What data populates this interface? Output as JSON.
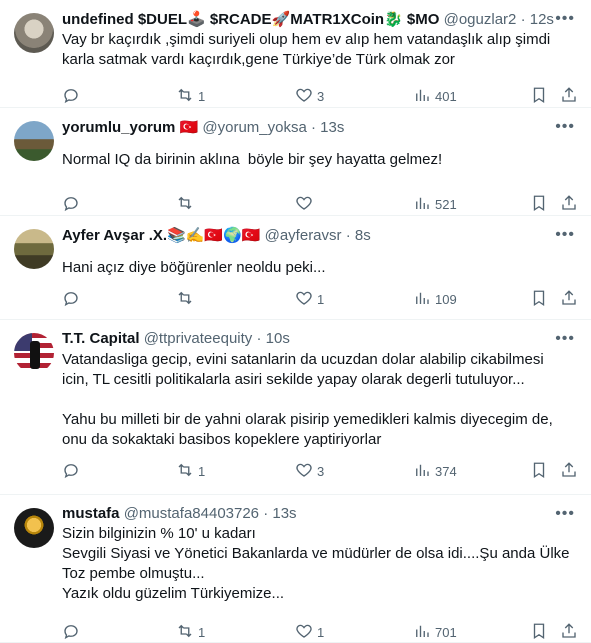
{
  "tweets": [
    {
      "name": "undefined $DUEL🕹️ $RCADE🚀MATR1XCoin🐉 $MO",
      "handle": "@oguzlar2",
      "time": "12s",
      "text": "Vay br kaçırdık ,şimdi suriyeli olup hem ev alıp hem vatandaşlık alıp şimdi karla satmak vardı kaçırdık,gene Türkiye’de Türk olmak zor",
      "replies": "",
      "retweets": "1",
      "likes": "3",
      "views": "401"
    },
    {
      "name": "yorumlu_yorum 🇹🇷",
      "handle": "@yorum_yoksa",
      "time": "13s",
      "text": "Normal IQ da birinin aklına  böyle bir şey hayatta gelmez!",
      "replies": "",
      "retweets": "",
      "likes": "",
      "views": "521"
    },
    {
      "name": "Ayfer Avşar .X.📚✍️🇹🇷🌍🇹🇷",
      "handle": "@ayferavsr",
      "time": "8s",
      "text": "Hani açız diye böğürenler neoldu peki...",
      "replies": "",
      "retweets": "",
      "likes": "1",
      "views": "109"
    },
    {
      "name": "T.T. Capital",
      "handle": "@ttprivateequity",
      "time": "10s",
      "text": "Vatandasliga gecip, evini satanlarin da ucuzdan dolar alabilip cikabilmesi icin, TL cesitli politikalarla asiri sekilde yapay olarak degerli tutuluyor...\n\nYahu bu milleti bir de yahni olarak pisirip yemedikleri kalmis diyecegim de, onu da sokaktaki basibos kopeklere yaptiriyorlar",
      "replies": "",
      "retweets": "1",
      "likes": "3",
      "views": "374"
    },
    {
      "name": "mustafa",
      "handle": "@mustafa84403726",
      "time": "13s",
      "text": "Sizin bilginizin % 10' u kadarı\nSevgili Siyasi ve Yönetici Bakanlarda ve müdürler de olsa idi....Şu anda Ülke Toz pembe olmuştu...\nYazık oldu güzelim Türkiyemize...",
      "replies": "",
      "retweets": "1",
      "likes": "1",
      "views": "701"
    }
  ],
  "separator": "·",
  "icons": {
    "reply": "reply-icon",
    "retweet": "retweet-icon",
    "like": "heart-icon",
    "views": "views-icon",
    "bookmark": "bookmark-icon",
    "share": "share-icon",
    "more": "more-icon"
  }
}
